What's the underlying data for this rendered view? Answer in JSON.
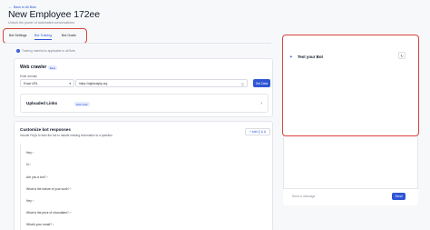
{
  "header": {
    "back_label": "Back to All Bots",
    "title": "New Employee 172ee",
    "subtitle": "Unlock the power of automated conversations"
  },
  "tabs": [
    {
      "label": "Bot Settings",
      "active": false
    },
    {
      "label": "Bot Training",
      "active": true
    },
    {
      "label": "Bot Goals",
      "active": false
    }
  ],
  "training_note": "Training material is applicable to all Bots",
  "web_crawler": {
    "title": "Web crawler",
    "badge": "Beta",
    "domain_label": "Enter domain",
    "select_value": "Exact URL",
    "url_value": "https://rightwaytip.org",
    "button_label": "Get Data",
    "uploaded_title": "Uploaded Links",
    "uploaded_badge": "Web links"
  },
  "responses": {
    "title": "Customize bot responses",
    "subtitle": "Include FAQs to train the bot to handle missing information to a question",
    "add_button": "+ Add Q & A",
    "questions": [
      "Hey",
      "hi",
      "Are you a bot?",
      "What is the nature of your work?",
      "Hey",
      "What is the price of chocolates?",
      "What's your email?"
    ]
  },
  "chat": {
    "title": "Test your Bot",
    "input_placeholder": "Send a message",
    "send_label": "Send"
  },
  "colors": {
    "accent": "#2f56d6",
    "highlight": "#d8443c"
  }
}
